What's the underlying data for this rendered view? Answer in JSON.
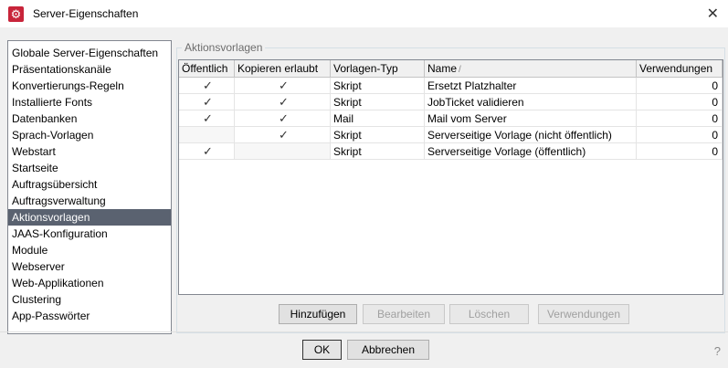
{
  "window": {
    "title": "Server-Eigenschaften",
    "close_glyph": "✕"
  },
  "sidebar": {
    "items": [
      {
        "label": "Globale Server-Eigenschaften",
        "selected": false
      },
      {
        "label": "Präsentationskanäle",
        "selected": false
      },
      {
        "label": "Konvertierungs-Regeln",
        "selected": false
      },
      {
        "label": "Installierte Fonts",
        "selected": false
      },
      {
        "label": "Datenbanken",
        "selected": false
      },
      {
        "label": "Sprach-Vorlagen",
        "selected": false
      },
      {
        "label": "Webstart",
        "selected": false
      },
      {
        "label": "Startseite",
        "selected": false
      },
      {
        "label": "Auftragsübersicht",
        "selected": false
      },
      {
        "label": "Auftragsverwaltung",
        "selected": false
      },
      {
        "label": "Aktionsvorlagen",
        "selected": true
      },
      {
        "label": "JAAS-Konfiguration",
        "selected": false
      },
      {
        "label": "Module",
        "selected": false
      },
      {
        "label": "Webserver",
        "selected": false
      },
      {
        "label": "Web-Applikationen",
        "selected": false
      },
      {
        "label": "Clustering",
        "selected": false
      },
      {
        "label": "App-Passwörter",
        "selected": false
      }
    ]
  },
  "group": {
    "title": "Aktionsvorlagen"
  },
  "table": {
    "columns": [
      "Öffentlich",
      "Kopieren erlaubt",
      "Vorlagen-Typ",
      "Name",
      "Verwendungen"
    ],
    "sort_indicator": "/",
    "rows": [
      {
        "public": "✓",
        "copy": "✓",
        "type": "Skript",
        "name": "Ersetzt Platzhalter",
        "uses": "0"
      },
      {
        "public": "✓",
        "copy": "✓",
        "type": "Skript",
        "name": "JobTicket validieren",
        "uses": "0"
      },
      {
        "public": "✓",
        "copy": "✓",
        "type": "Mail",
        "name": "Mail vom Server",
        "uses": "0"
      },
      {
        "public": "",
        "copy": "✓",
        "type": "Skript",
        "name": "Serverseitige Vorlage (nicht öffentlich)",
        "uses": "0"
      },
      {
        "public": "✓",
        "copy": "",
        "type": "Skript",
        "name": "Serverseitige Vorlage (öffentlich)",
        "uses": "0"
      }
    ]
  },
  "buttons": {
    "add": "Hinzufügen",
    "edit": "Bearbeiten",
    "delete": "Löschen",
    "usages": "Verwendungen",
    "ok": "OK",
    "cancel": "Abbrechen"
  },
  "help_glyph": "?",
  "colors": {
    "selection": "#5a6270",
    "app_icon": "#c8243a"
  }
}
